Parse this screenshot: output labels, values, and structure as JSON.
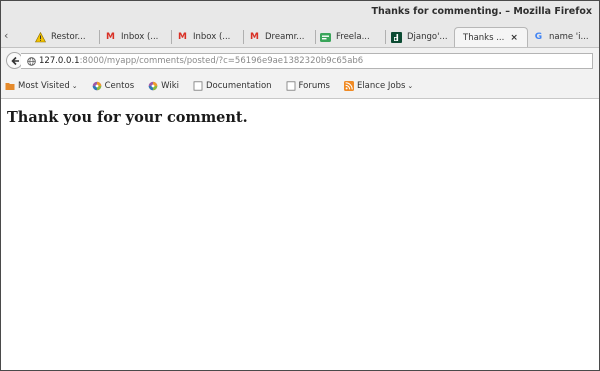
{
  "window": {
    "title": "Thanks for commenting. – Mozilla Firefox"
  },
  "tabs": [
    {
      "label": "Restor...",
      "icon": "warning-icon",
      "active": false
    },
    {
      "label": "Inbox (...",
      "icon": "gmail-icon",
      "active": false
    },
    {
      "label": "Inbox (...",
      "icon": "gmail-icon",
      "active": false
    },
    {
      "label": "Dreamr...",
      "icon": "gmail-icon",
      "active": false
    },
    {
      "label": "Freela...",
      "icon": "freelancer-icon",
      "active": false
    },
    {
      "label": "Django'...",
      "icon": "django-icon",
      "active": false
    },
    {
      "label": "Thanks ...",
      "icon": "",
      "active": true
    },
    {
      "label": "name 'i...",
      "icon": "google-icon",
      "active": false
    }
  ],
  "tab_close_glyph": "×",
  "navigation": {
    "url_host": "127.0.0.1",
    "url_rest": ":8000/myapp/comments/posted/?c=56196e9ae1382320b9c65ab6"
  },
  "bookmarks": [
    {
      "label": "Most Visited",
      "icon": "folder-icon",
      "dropdown": true
    },
    {
      "label": "Centos",
      "icon": "centos-icon",
      "dropdown": false
    },
    {
      "label": "Wiki",
      "icon": "centos-icon",
      "dropdown": false
    },
    {
      "label": "Documentation",
      "icon": "page-icon",
      "dropdown": false
    },
    {
      "label": "Forums",
      "icon": "page-icon",
      "dropdown": false
    },
    {
      "label": "Elance Jobs",
      "icon": "rss-icon",
      "dropdown": true
    }
  ],
  "page": {
    "heading": "Thank you for your comment."
  },
  "colors": {
    "gmail_red": "#d93025",
    "warning_yellow": "#f2c200",
    "freelancer_green": "#3aa55a",
    "django_green": "#0c4b33",
    "rss_orange": "#f08a24",
    "folder_orange": "#e58a2b"
  }
}
